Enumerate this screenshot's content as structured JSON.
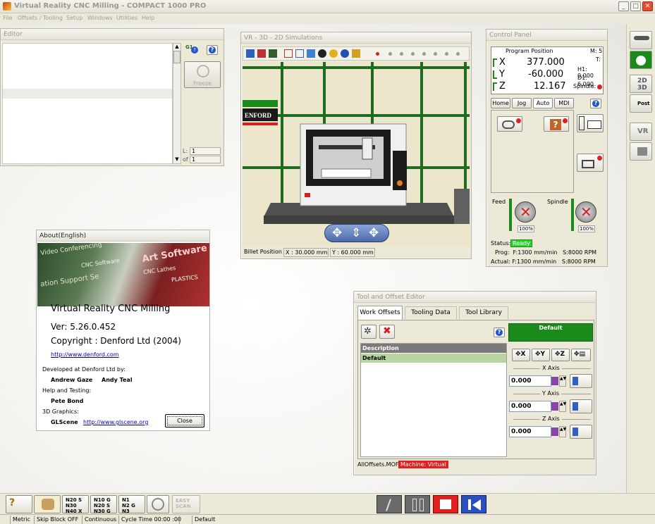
{
  "window": {
    "title": "Virtual Reality CNC Milling  -  COMPACT 1000 PRO"
  },
  "menu": [
    "File",
    "Offsets / Tooling",
    "Setup",
    "Windows",
    "Utilities",
    "Help"
  ],
  "editor": {
    "title": "Editor",
    "freeze": "Freeze",
    "line_label": "L:",
    "line_value": "1",
    "of_label": "of",
    "of_value": "1"
  },
  "vr": {
    "title": "VR - 3D - 2D Simulations",
    "brand": "ENFORD",
    "status_label": "Billet Position",
    "x_pos": "X : 30.000  mm",
    "y_pos": "Y : 60.000  mm"
  },
  "control": {
    "title": "Control Panel",
    "program_position": "Program Position",
    "m": "M: 5",
    "t": "T:",
    "h1": "H1: 0.000",
    "d1": "D1: 6.000",
    "spindle": "Spindle:",
    "x_label": "X",
    "x_value": "377.000",
    "y_label": "Y",
    "y_value": "-60.000",
    "z_label": "Z",
    "z_value": "12.167",
    "tabs": [
      "Home",
      "Jog",
      "Auto",
      "MDI"
    ],
    "feed": "Feed",
    "spindle_label": "Spindle",
    "feed_pct": "100%",
    "spindle_pct": "100%",
    "status_label": "Status:",
    "status_value": "Ready",
    "prog": "Prog:  F:1300 mm/min   S:8000 RPM",
    "actual": "Actual: F:1300 mm/min   S:8000 RPM"
  },
  "about": {
    "title": "About(English)",
    "product": "Virtual Reality CNC Milling",
    "version": "Ver: 5.26.0.452",
    "copyright": "Copyright : Denford Ltd (2004)",
    "url": "http://www.denford.com",
    "dev_label": "Developed at Denford Ltd by:",
    "dev1": "Andrew Gaze",
    "dev2": "Andy Teal",
    "help_label": "Help and Testing:",
    "tester": "Pete Bond",
    "graphics_label": "3D Graphics:",
    "glscene": "GLScene",
    "glscene_url": "http://www.glscene.org",
    "close": "Close",
    "banner_words": [
      "Video Conferencing",
      "CNC Software",
      "CNC Lathes",
      "Art Software",
      "ation Support Se",
      "PLASTICS"
    ]
  },
  "tool_offset": {
    "title": "Tool and Offset Editor",
    "tabs": [
      "Work Offsets",
      "Tooling Data",
      "Tool Library"
    ],
    "default_header": "Default",
    "col_description": "Description",
    "row_default": "Default",
    "axes": [
      {
        "label": "X Axis",
        "value": "0.000"
      },
      {
        "label": "Y Axis",
        "value": "0.000"
      },
      {
        "label": "Z Axis",
        "value": "0.000"
      }
    ],
    "file": "AllOffsets.MOF",
    "machine": "Machine: Virtual"
  },
  "statusbar": [
    "Metric",
    "Skip Block OFF",
    "Continuous",
    "Cycle Time 00:00 :00",
    "Default"
  ],
  "colors": {
    "accent_green": "#1a8a1a",
    "status_ready": "#2dd02d",
    "machine_red": "#e02020",
    "desktop": "#f4f3f0"
  }
}
